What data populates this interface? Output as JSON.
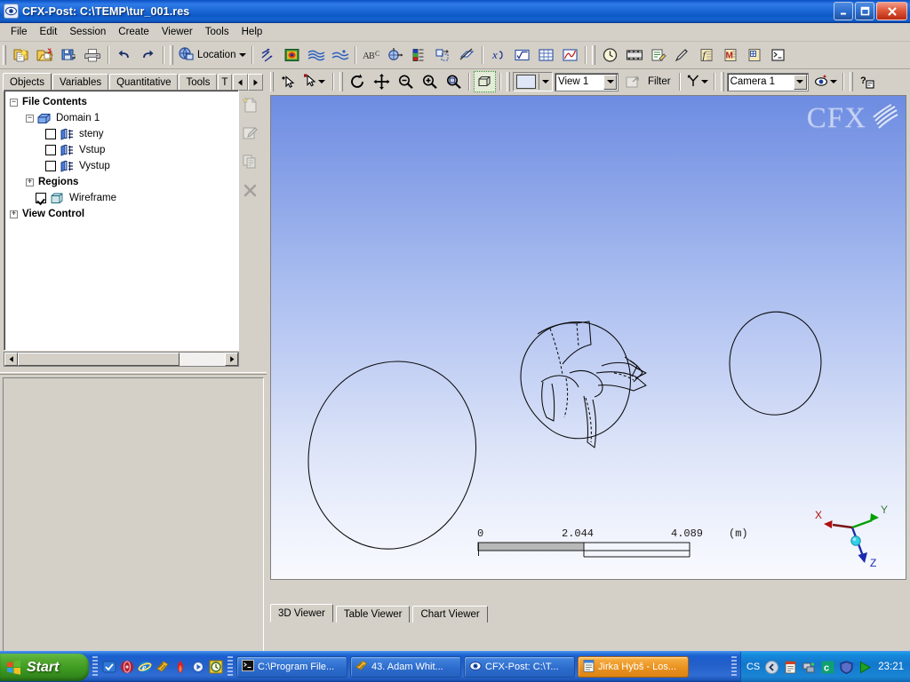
{
  "window": {
    "title": "CFX-Post: C:\\TEMP\\tur_001.res",
    "app_icon": "eye-icon",
    "minimize_label": "_",
    "maximize_label": "□",
    "close_label": "✕"
  },
  "menu": {
    "items": [
      {
        "label": "File"
      },
      {
        "label": "Edit"
      },
      {
        "label": "Session"
      },
      {
        "label": "Create"
      },
      {
        "label": "Viewer"
      },
      {
        "label": "Tools"
      },
      {
        "label": "Help"
      }
    ]
  },
  "toolbar": {
    "groups": [
      {
        "buttons": [
          {
            "name": "new-file-icon",
            "tip": "New"
          },
          {
            "name": "open-file-icon",
            "tip": "Open"
          },
          {
            "name": "save-file-icon",
            "tip": "Save"
          },
          {
            "name": "print-icon",
            "tip": "Print"
          }
        ]
      },
      {
        "buttons": [
          {
            "name": "undo-icon",
            "tip": "Undo"
          },
          {
            "name": "redo-icon",
            "tip": "Redo"
          }
        ]
      },
      {
        "combo": {
          "name": "location-dropdown",
          "label": "Location",
          "icon": "location-icon"
        }
      },
      {
        "buttons": [
          {
            "name": "vector-icon",
            "tip": "Vector"
          },
          {
            "name": "contour-icon",
            "tip": "Contour"
          },
          {
            "name": "streamline-icon",
            "tip": "Streamline"
          },
          {
            "name": "particle-track-icon",
            "tip": "Particle Track"
          }
        ]
      },
      {
        "buttons": [
          {
            "name": "text-icon",
            "tip": "Text"
          },
          {
            "name": "coordinate-frame-icon",
            "tip": "Coordinate Frame"
          },
          {
            "name": "legend-icon",
            "tip": "Legend"
          },
          {
            "name": "instance-transform-icon",
            "tip": "Instance Transform"
          },
          {
            "name": "clip-plane-icon",
            "tip": "Clip Plane"
          }
        ]
      },
      {
        "buttons": [
          {
            "name": "expression-icon",
            "tip": "Expression"
          },
          {
            "name": "variable-icon",
            "tip": "Variable"
          },
          {
            "name": "table-icon",
            "tip": "Table"
          },
          {
            "name": "chart-icon",
            "tip": "Chart"
          }
        ]
      },
      {
        "buttons": [
          {
            "name": "timestep-icon",
            "tip": "Timestep Selector"
          },
          {
            "name": "animation-icon",
            "tip": "Animation"
          },
          {
            "name": "report-icon",
            "tip": "Report"
          },
          {
            "name": "probe-icon",
            "tip": "Probe"
          },
          {
            "name": "function-calculator-icon",
            "tip": "Function Calculator"
          },
          {
            "name": "macro-calculator-icon",
            "tip": "Macro Calculator"
          },
          {
            "name": "mesh-calculator-icon",
            "tip": "Mesh Calculator"
          },
          {
            "name": "command-editor-icon",
            "tip": "Command Editor"
          }
        ]
      }
    ]
  },
  "left_panel": {
    "tabs": [
      {
        "label": "Objects",
        "active": true
      },
      {
        "label": "Variables",
        "active": false
      },
      {
        "label": "Quantitative",
        "active": false
      },
      {
        "label": "Tools",
        "active": false
      },
      {
        "label": "T",
        "active": false,
        "clipped": true
      }
    ],
    "tab_scroll_left": "◄",
    "tab_scroll_right": "►",
    "tree": [
      {
        "label": "File Contents",
        "bold": true,
        "expander": "−",
        "indent": 0,
        "checkbox": null,
        "icon": null
      },
      {
        "label": "Domain 1",
        "bold": false,
        "expander": "−",
        "indent": 1,
        "checkbox": null,
        "icon": "domain-icon"
      },
      {
        "label": "steny",
        "bold": false,
        "expander": null,
        "indent": 2,
        "checkbox": false,
        "icon": "boundary-icon"
      },
      {
        "label": "Vstup",
        "bold": false,
        "expander": null,
        "indent": 2,
        "checkbox": false,
        "icon": "boundary-icon"
      },
      {
        "label": "Vystup",
        "bold": false,
        "expander": null,
        "indent": 2,
        "checkbox": false,
        "icon": "boundary-icon"
      },
      {
        "label": "Regions",
        "bold": true,
        "expander": "+",
        "indent": 1,
        "checkbox": null,
        "icon": null
      },
      {
        "label": "Wireframe",
        "bold": false,
        "expander": null,
        "indent": 1,
        "checkbox": true,
        "icon": "wireframe-icon"
      },
      {
        "label": "View Control",
        "bold": true,
        "expander": "+",
        "indent": 0,
        "checkbox": null,
        "icon": null
      }
    ],
    "side_buttons": [
      {
        "name": "new-object-icon"
      },
      {
        "name": "edit-object-icon"
      },
      {
        "name": "duplicate-object-icon"
      },
      {
        "name": "delete-object-icon"
      }
    ],
    "hscroll": {
      "left_arrow": "◄",
      "right_arrow": "►"
    }
  },
  "viewer_toolbar": {
    "select_buttons": [
      {
        "name": "pick-single-icon"
      },
      {
        "name": "pick-mode-dropdown",
        "has_caret": true
      }
    ],
    "nav_buttons": [
      {
        "name": "rotate-icon"
      },
      {
        "name": "pan-icon"
      },
      {
        "name": "zoom-box-icon"
      },
      {
        "name": "zoom-icon"
      },
      {
        "name": "fit-view-icon"
      }
    ],
    "extra_buttons": [
      {
        "name": "toggle-bounding-box-icon"
      }
    ],
    "color_swatch": {
      "name": "background-color-swatch",
      "has_caret": true
    },
    "view_select": {
      "name": "view-dropdown",
      "value": "View 1"
    },
    "snapshot_button": {
      "name": "snapshot-icon"
    },
    "filter_label": "Filter",
    "axis_button": {
      "name": "axis-orientation-icon",
      "has_caret": true
    },
    "camera_select": {
      "name": "camera-dropdown",
      "value": "Camera 1"
    },
    "visibility_button": {
      "name": "visibility-eye-icon",
      "has_caret": true
    },
    "help_button": {
      "name": "context-help-icon"
    }
  },
  "viewport": {
    "watermark": "CFX",
    "scale_bar": {
      "ticks": [
        "0",
        "2.044",
        "4.089"
      ],
      "unit": "(m)"
    },
    "axis_triad": {
      "x_label": "X",
      "y_label": "Y",
      "z_label": "Z",
      "x_color": "#c00000",
      "y_color": "#00a000",
      "z_color": "#1a2ab0",
      "origin_color": "#30d0e8"
    },
    "background_top": "#6d8ce2",
    "background_bottom": "#f8fafe",
    "geometry_line_color": "#000000"
  },
  "viewer_tabs": [
    {
      "label": "3D Viewer",
      "active": true
    },
    {
      "label": "Table Viewer",
      "active": false
    },
    {
      "label": "Chart Viewer",
      "active": false
    }
  ],
  "taskbar": {
    "start_label": "Start",
    "quick_launch": [
      {
        "name": "show-desktop-icon"
      },
      {
        "name": "media-player-icon"
      },
      {
        "name": "internet-explorer-icon"
      },
      {
        "name": "winamp-icon"
      },
      {
        "name": "flame-icon"
      },
      {
        "name": "dvd-player-icon"
      },
      {
        "name": "clock-app-icon"
      }
    ],
    "tasks": [
      {
        "label": "C:\\Program File...",
        "icon": "console-icon",
        "active": false
      },
      {
        "label": "43. Adam Whit...",
        "icon": "winamp-icon",
        "active": false
      },
      {
        "label": "CFX-Post: C:\\T...",
        "icon": "eye-icon",
        "active": false
      },
      {
        "label": "Jirka Hybš - Los...",
        "icon": "notepad-icon",
        "active": true
      }
    ],
    "tray": {
      "language": "CS",
      "icons": [
        {
          "name": "tray-expand-icon"
        },
        {
          "name": "tray-notepad-icon"
        },
        {
          "name": "tray-network-icon"
        },
        {
          "name": "tray-messenger-icon"
        },
        {
          "name": "tray-security-icon"
        },
        {
          "name": "tray-play-icon"
        }
      ],
      "clock": "23:21"
    }
  }
}
